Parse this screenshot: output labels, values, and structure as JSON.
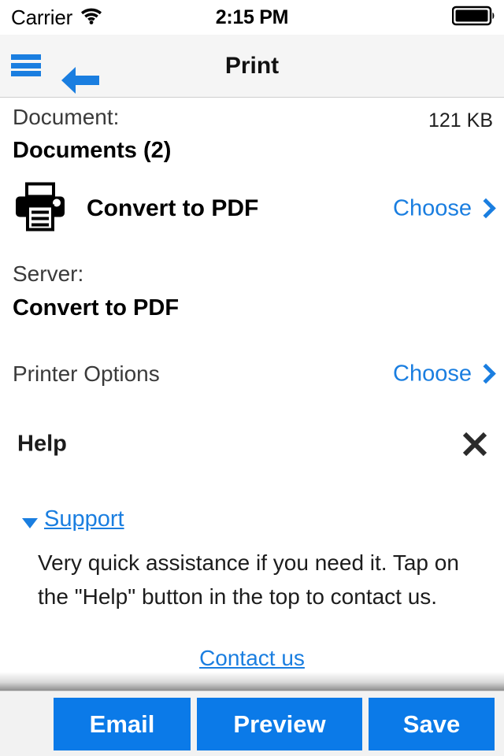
{
  "status_bar": {
    "carrier": "Carrier",
    "wifi_icon": "wifi-icon",
    "time": "2:15 PM",
    "battery_icon": "battery-full-icon"
  },
  "nav_bar": {
    "menu_icon": "hamburger-menu-icon",
    "back_icon": "back-arrow-icon",
    "title": "Print"
  },
  "document": {
    "label": "Document:",
    "size": "121 KB",
    "name": "Documents (2)"
  },
  "printer": {
    "icon": "printer-icon",
    "name": "Convert to PDF",
    "choose_label": "Choose",
    "chevron_icon": "chevron-right-icon"
  },
  "server": {
    "label": "Server:",
    "name": "Convert to PDF"
  },
  "printer_options": {
    "label": "Printer Options",
    "choose_label": "Choose",
    "chevron_icon": "chevron-right-icon"
  },
  "help": {
    "title": "Help",
    "close_icon": "close-x-icon",
    "disclosure_icon": "triangle-down-icon",
    "support_link": "Support",
    "support_text": "Very quick assistance if you need it. Tap on the \"Help\" button in the top to contact us.",
    "contact_link": "Contact us"
  },
  "toolbar": {
    "email_label": "Email",
    "preview_label": "Preview",
    "save_label": "Save"
  },
  "colors": {
    "accent_blue": "#1a7ee0",
    "button_blue": "#0b7ae8",
    "nav_background": "#f5f5f5",
    "toolbar_background": "#f2f2f2"
  }
}
